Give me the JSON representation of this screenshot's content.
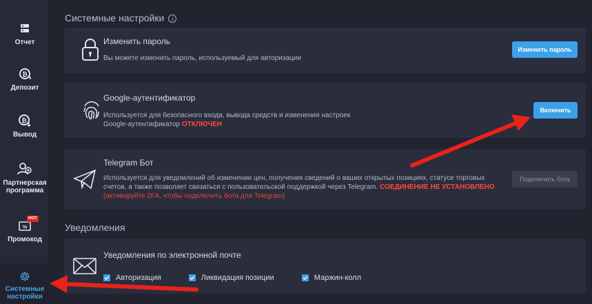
{
  "sidebar": {
    "items": [
      {
        "label": "Отчет",
        "icon": "server-icon"
      },
      {
        "label": "Депозит",
        "icon": "coin-deposit-icon"
      },
      {
        "label": "Вывод",
        "icon": "coin-withdraw-icon"
      },
      {
        "label": "Партнерская программа",
        "icon": "partners-icon"
      },
      {
        "label": "Промокод",
        "icon": "promo-icon",
        "badge": "HOT"
      },
      {
        "label": "Системные настройки",
        "icon": "gear-icon",
        "active": true
      }
    ]
  },
  "system_settings": {
    "title": "Системные настройки",
    "info": "i",
    "password": {
      "title": "Изменить пароль",
      "desc": "Вы можете изменить пароль, используемый для авторизации",
      "button": "Изменить пароль"
    },
    "google": {
      "title": "Google-аутентификатор",
      "desc_line1": "Используется для безопасного входа, вывода средств и изменения настроек",
      "desc_line2": "Google-аутентификатор",
      "status": "ОТКЛЮЧЕН",
      "button": "Включить"
    },
    "telegram": {
      "title": "Telegram Бот",
      "desc_line1": "Используется для уведомлений об изменении цен, получения сведений о ваших открытых позициях, статусе торговых",
      "desc_line2": "счетов, а также позволяет связаться с пользовательской поддержкой через Telegram.",
      "status": "СОЕДИНЕНИЕ НЕ УСТАНОВЛЕНО",
      "hint": "(активируйте 2FA, чтобы подключить бота для Telegram)",
      "button": "Подключить бота"
    }
  },
  "notifications": {
    "title": "Уведомления",
    "email": {
      "title": "Уведомления по электронной почте",
      "options": [
        "Авторизация",
        "Ликвидация позиции",
        "Маржин-колл"
      ]
    }
  },
  "colors": {
    "accent": "#3ea0e8",
    "danger": "#ff4a3d",
    "arrow": "#e8231b"
  }
}
